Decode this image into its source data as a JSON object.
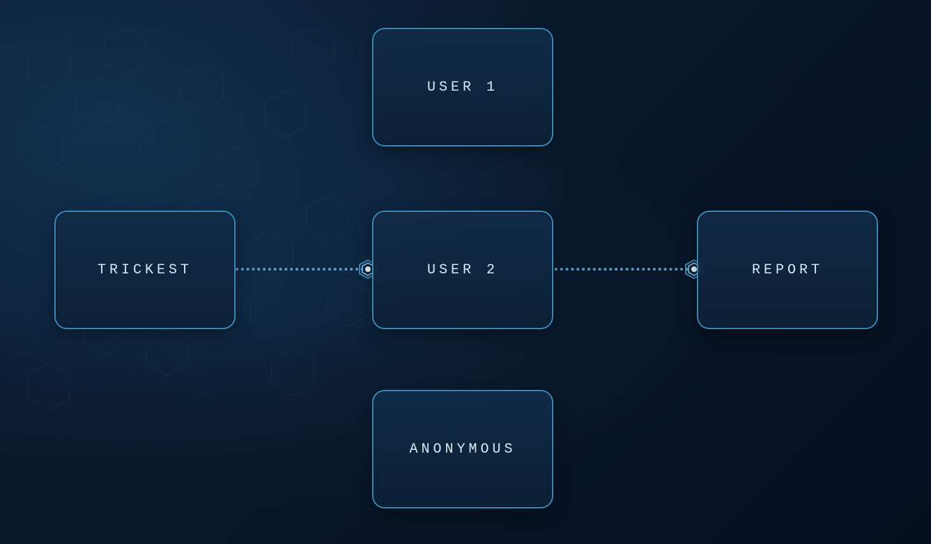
{
  "diagram": {
    "nodes": {
      "left": {
        "label": "TRICKEST"
      },
      "top": {
        "label": "USER 1"
      },
      "center": {
        "label": "USER 2"
      },
      "bottom": {
        "label": "ANONYMOUS"
      },
      "right": {
        "label": "REPORT"
      }
    },
    "colors": {
      "node_border": "#3a88b7",
      "node_fill_top": "#112c49",
      "node_fill_bottom": "#0c2137",
      "text": "#d9eaf4",
      "connector": "#6fb2d6",
      "port_outer": "#3a88b7",
      "port_inner": "#cfe8f7",
      "background_base": "#081526"
    }
  }
}
